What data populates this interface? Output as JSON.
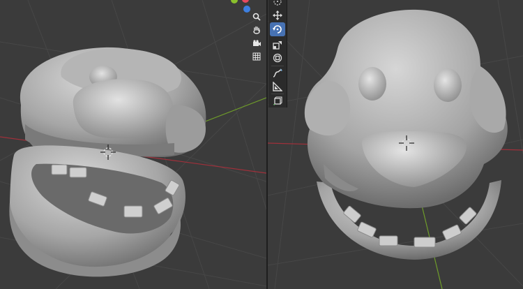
{
  "app": {
    "name": "3D Viewport"
  },
  "left_viewport": {
    "navigation": [
      {
        "icon": "zoom-icon"
      },
      {
        "icon": "hand-pan-icon"
      },
      {
        "icon": "camera-icon"
      },
      {
        "icon": "grid-icon"
      }
    ],
    "axis_colors": {
      "x": "#e84a5f",
      "y": "#8ac02c",
      "z": "#3d7fe0"
    }
  },
  "right_viewport": {
    "toolbar": [
      {
        "icon": "cursor-icon",
        "active": false
      },
      {
        "icon": "move-icon",
        "active": false
      },
      {
        "icon": "rotate-icon",
        "active": true
      },
      {
        "icon": "scale-icon",
        "active": false
      },
      {
        "icon": "transform-icon",
        "active": false
      },
      {
        "icon": "annotate-icon",
        "active": false
      },
      {
        "icon": "measure-icon",
        "active": false
      },
      {
        "icon": "add-cube-icon",
        "active": false
      }
    ],
    "active_color": "#4772b3"
  }
}
